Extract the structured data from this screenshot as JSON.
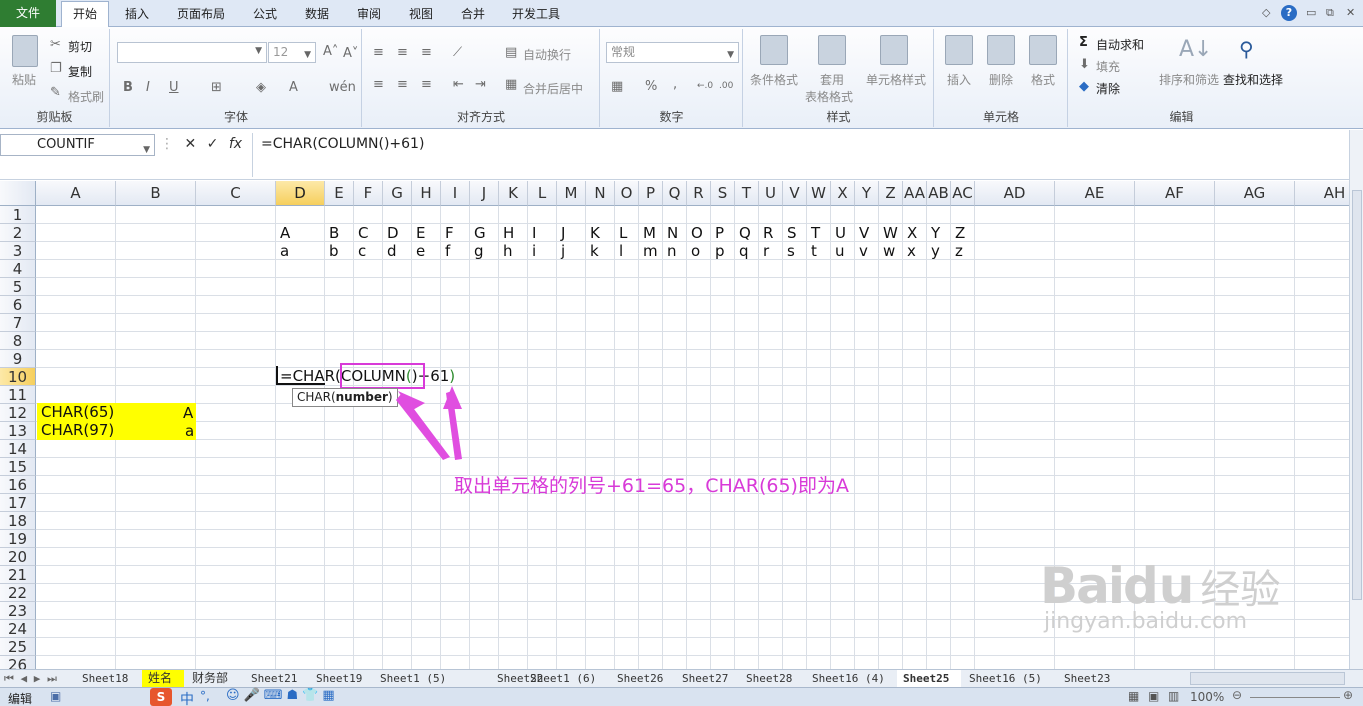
{
  "ribbon_tabs": {
    "file": "文件",
    "home": "开始",
    "insert": "插入",
    "page_layout": "页面布局",
    "formulas": "公式",
    "data": "数据",
    "review": "审阅",
    "view": "视图",
    "merge": "合并",
    "developer": "开发工具"
  },
  "clipboard": {
    "paste": "粘贴",
    "cut": "剪切",
    "copy": "复制",
    "format_painter": "格式刷",
    "label": "剪贴板"
  },
  "font": {
    "size": "12",
    "bold": "B",
    "italic": "I",
    "underline": "U",
    "label": "字体"
  },
  "alignment": {
    "wrap": "自动换行",
    "merge_center": "合并后居中",
    "label": "对齐方式"
  },
  "number": {
    "format": "常规",
    "percent": "%",
    "comma": ",",
    "label": "数字"
  },
  "styles": {
    "conditional": "条件格式",
    "table_line1": "套用",
    "table_line2": "表格格式",
    "cell_styles": "单元格样式",
    "label": "样式"
  },
  "cells": {
    "insert": "插入",
    "delete": "删除",
    "format": "格式",
    "label": "单元格"
  },
  "editing": {
    "autosum": "自动求和",
    "fill": "填充",
    "clear": "清除",
    "sort_filter": "排序和筛选",
    "find_select": "查找和选择",
    "label": "编辑",
    "sigma": "Σ"
  },
  "formula_bar": {
    "name_box": "COUNTIF",
    "cancel": "✕",
    "enter": "✓",
    "fx": "fx",
    "formula": "=CHAR(COLUMN()+61)"
  },
  "columns": [
    "A",
    "B",
    "C",
    "D",
    "E",
    "F",
    "G",
    "H",
    "I",
    "J",
    "K",
    "L",
    "M",
    "N",
    "O",
    "P",
    "Q",
    "R",
    "S",
    "T",
    "U",
    "V",
    "W",
    "X",
    "Y",
    "Z",
    "AA",
    "AB",
    "AC",
    "AD",
    "AE",
    "AF",
    "AG",
    "AH"
  ],
  "rows": [
    "1",
    "2",
    "3",
    "4",
    "5",
    "6",
    "7",
    "8",
    "9",
    "10",
    "11",
    "12",
    "13",
    "14",
    "15",
    "16",
    "17",
    "18",
    "19",
    "20",
    "21",
    "22",
    "23",
    "24",
    "25",
    "26"
  ],
  "row2": [
    "A",
    "B",
    "C",
    "D",
    "E",
    "F",
    "G",
    "H",
    "I",
    "J",
    "K",
    "L",
    "M",
    "N",
    "O",
    "P",
    "Q",
    "R",
    "S",
    "T",
    "U",
    "V",
    "W",
    "X",
    "Y",
    "Z"
  ],
  "row3": [
    "a",
    "b",
    "c",
    "d",
    "e",
    "f",
    "g",
    "h",
    "i",
    "j",
    "k",
    "l",
    "m",
    "n",
    "o",
    "p",
    "q",
    "r",
    "s",
    "t",
    "u",
    "v",
    "w",
    "x",
    "y",
    "z"
  ],
  "edit_cell": {
    "p1": "=CHAR(",
    "p2": "COLUMN",
    "p3": "(",
    "p4": ")",
    "p5": "+61",
    "p6": ")",
    "tooltip_func": "CHAR(",
    "tooltip_arg": "number",
    "tooltip_close": ")"
  },
  "cells_ab": {
    "a12": "CHAR(65)",
    "b12": "A",
    "a13": "CHAR(97)",
    "b13": "a"
  },
  "annotation": "取出单元格的列号+61=65，CHAR(65)即为A",
  "sheet_tabs": [
    "Sheet18",
    "姓名",
    "财务部",
    "Sheet21",
    "Sheet19",
    "Sheet1 (5)",
    "Sheet22",
    "Sheet1 (6)",
    "Sheet26",
    "Sheet27",
    "Sheet28",
    "Sheet16 (4)",
    "Sheet25",
    "Sheet16 (5)",
    "Sheet23"
  ],
  "status": {
    "mode": "编辑",
    "zoom": "100%"
  },
  "ime": {
    "lang": "中",
    "punct": "°,"
  },
  "watermark": {
    "brand": "Bai",
    "brand2": "du",
    "cn": "经验",
    "url": "jingyan.baidu.com"
  },
  "colors": {
    "accent": "#d83ad8",
    "highlight": "#ffff00",
    "file_tab": "#2f7d32"
  }
}
